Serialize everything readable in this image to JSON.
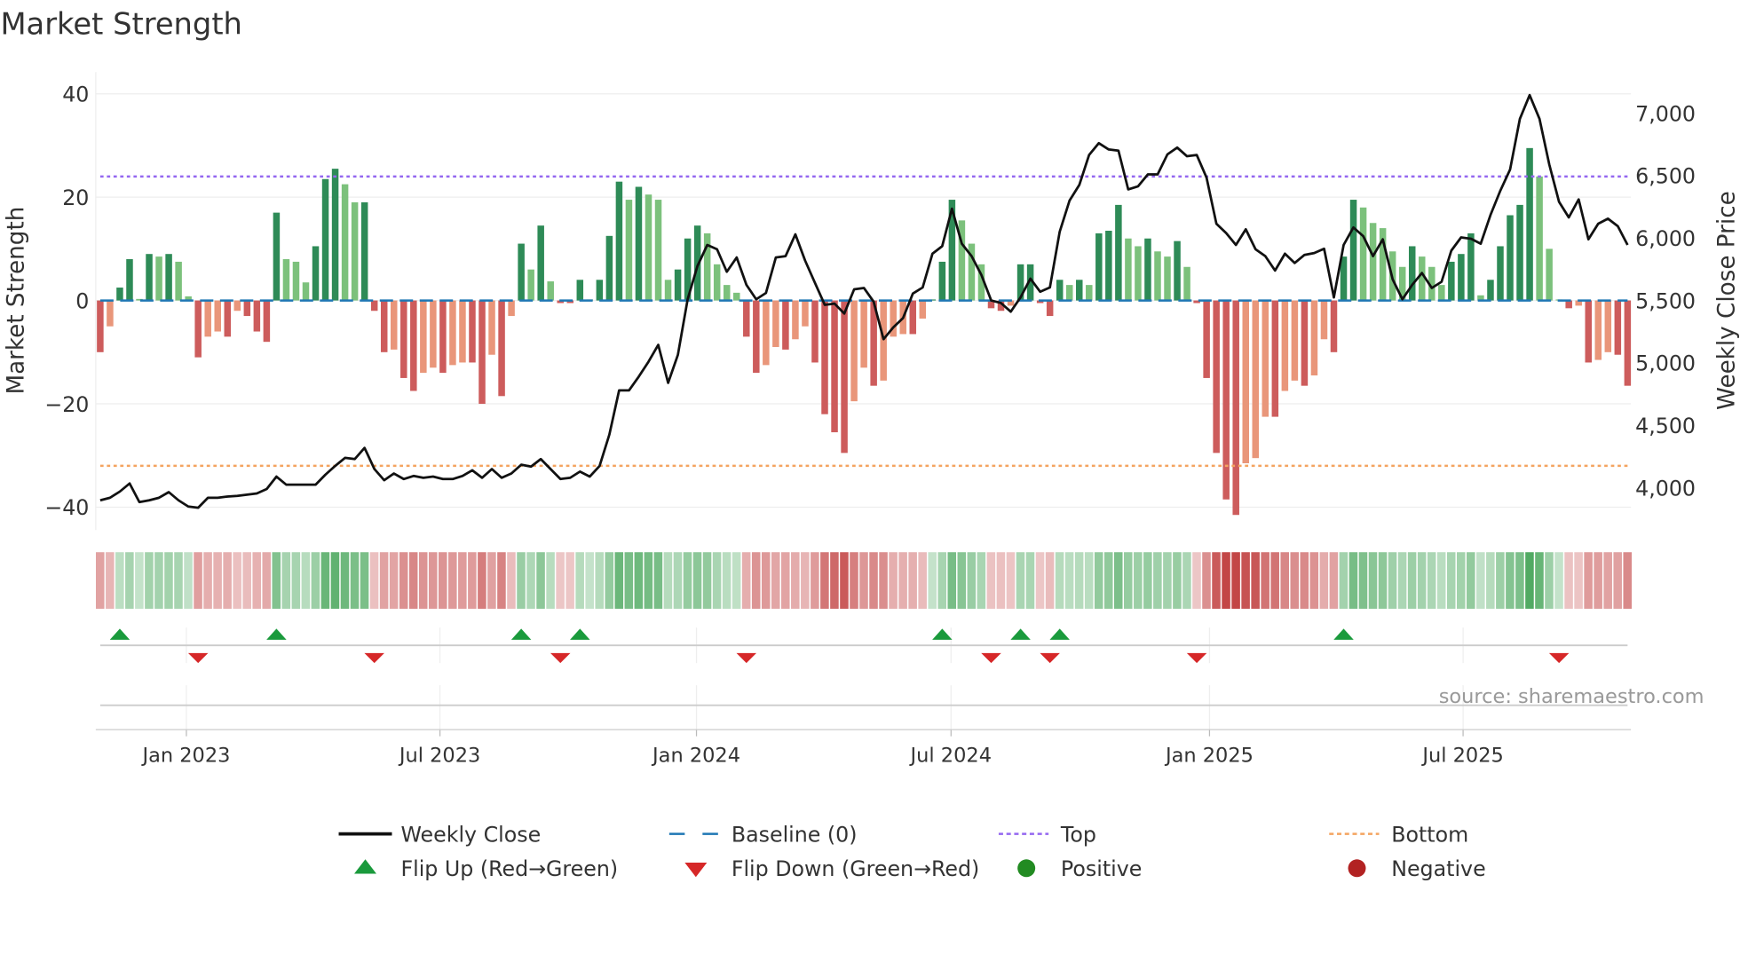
{
  "chart_data": {
    "type": "bar",
    "title": "Market Strength",
    "ylabel": "Market Strength",
    "y2label": "Weekly Close Price",
    "ylim": [
      -44,
      44
    ],
    "y2lim": [
      3750,
      7250
    ],
    "yticks": [
      {
        "v": 40,
        "label": "40"
      },
      {
        "v": 20,
        "label": "20"
      },
      {
        "v": 0,
        "label": "0"
      },
      {
        "v": -20,
        "label": "−20"
      },
      {
        "v": -40,
        "label": "−40"
      }
    ],
    "y2ticks": [
      {
        "v": 7000,
        "label": "7,000"
      },
      {
        "v": 6500,
        "label": "6,500"
      },
      {
        "v": 6000,
        "label": "6,000"
      },
      {
        "v": 5500,
        "label": "5,500"
      },
      {
        "v": 5000,
        "label": "5,000"
      },
      {
        "v": 4500,
        "label": "4,500"
      },
      {
        "v": 4000,
        "label": "4,000"
      }
    ],
    "xticks": [
      {
        "week": 8.8,
        "label": "Jan 2023"
      },
      {
        "week": 34.7,
        "label": "Jul 2023"
      },
      {
        "week": 60.9,
        "label": "Jan 2024"
      },
      {
        "week": 86.9,
        "label": "Jul 2024"
      },
      {
        "week": 113.3,
        "label": "Jan 2025"
      },
      {
        "week": 139.2,
        "label": "Jul 2025"
      }
    ],
    "top_level": 24,
    "bottom_level": -32,
    "strength": [
      -10,
      -5,
      2.5,
      8,
      0.3,
      9,
      8.5,
      9,
      7.5,
      0.8,
      -11,
      -7,
      -6,
      -7,
      -2,
      -3,
      -6,
      -8,
      17,
      8,
      7.5,
      3.5,
      10.5,
      23.5,
      25.5,
      22.5,
      19,
      19,
      -2,
      -10,
      -9.5,
      -15,
      -17.5,
      -14,
      -13,
      -14,
      -12.5,
      -12,
      -12,
      -20,
      -10.5,
      -18.5,
      -3,
      11,
      6,
      14.5,
      3.7,
      -0.5,
      -0.5,
      4,
      0.2,
      4,
      12.5,
      23,
      19.5,
      22,
      20.5,
      19.5,
      4,
      6,
      12,
      14.5,
      13,
      7,
      3,
      1.5,
      -7,
      -14,
      -12.5,
      -9,
      -9.5,
      -7.5,
      -5,
      -12,
      -22,
      -25.5,
      -29.5,
      -19.5,
      -13,
      -16.5,
      -15.5,
      -7,
      -6.5,
      -6.5,
      -3.5,
      0.2,
      7.5,
      19.5,
      15.5,
      11,
      7,
      -1.5,
      -2,
      -1,
      7,
      7,
      -0.5,
      -3,
      4,
      3,
      4,
      3,
      13,
      13.5,
      18.5,
      12,
      10.5,
      12,
      9.5,
      8.5,
      11.5,
      6.5,
      -0.5,
      -15,
      -29.5,
      -38.5,
      -41.5,
      -31.5,
      -30.5,
      -22.5,
      -22.5,
      -17.5,
      -15.5,
      -16.5,
      -14.5,
      -7.5,
      -10,
      8.5,
      19.5,
      18,
      15,
      14,
      9.5,
      6.5,
      10.5,
      8.5,
      6.5,
      3,
      7.5,
      9,
      13,
      1,
      4,
      10.5,
      16.5,
      18.5,
      29.5,
      24,
      10,
      0.2,
      -1.5,
      -1,
      -12,
      -11.5,
      -10,
      -10.5,
      -16.5
    ],
    "weekly_close": [
      3900,
      3920,
      3970,
      4035,
      3885,
      3900,
      3920,
      3965,
      3900,
      3850,
      3840,
      3920,
      3920,
      3930,
      3935,
      3945,
      3955,
      3990,
      4090,
      4025,
      4025,
      4025,
      4025,
      4105,
      4175,
      4240,
      4230,
      4320,
      4150,
      4060,
      4115,
      4070,
      4095,
      4080,
      4090,
      4070,
      4070,
      4095,
      4140,
      4080,
      4150,
      4080,
      4115,
      4185,
      4170,
      4230,
      4150,
      4070,
      4080,
      4130,
      4090,
      4175,
      4425,
      4780,
      4780,
      4890,
      5010,
      5145,
      4840,
      5065,
      5510,
      5775,
      5945,
      5910,
      5730,
      5845,
      5625,
      5510,
      5560,
      5845,
      5855,
      6030,
      5820,
      5640,
      5465,
      5475,
      5395,
      5590,
      5600,
      5490,
      5190,
      5285,
      5360,
      5555,
      5605,
      5875,
      5935,
      6235,
      5955,
      5855,
      5705,
      5500,
      5480,
      5410,
      5525,
      5675,
      5570,
      5605,
      6050,
      6300,
      6425,
      6665,
      6760,
      6710,
      6700,
      6390,
      6415,
      6510,
      6510,
      6670,
      6725,
      6655,
      6665,
      6485,
      6115,
      6040,
      5945,
      6070,
      5910,
      5855,
      5740,
      5875,
      5800,
      5865,
      5880,
      5915,
      5525,
      5945,
      6085,
      6015,
      5855,
      5990,
      5670,
      5510,
      5625,
      5720,
      5600,
      5650,
      5900,
      6005,
      5995,
      5955,
      6185,
      6380,
      6550,
      6955,
      7145,
      6955,
      6590,
      6290,
      6165,
      6310,
      5990,
      6115,
      6155,
      6095,
      5945
    ],
    "flip_up_weeks": [
      2,
      18,
      43,
      49,
      86,
      94,
      98,
      127
    ],
    "flip_down_weeks": [
      10,
      28,
      47,
      66,
      91,
      97,
      112,
      149
    ],
    "source": "source: sharemaestro.com",
    "legend": [
      {
        "label": "Weekly Close",
        "kind": "line"
      },
      {
        "label": "Baseline (0)",
        "kind": "dash"
      },
      {
        "label": "Top",
        "kind": "top"
      },
      {
        "label": "Bottom",
        "kind": "bottom"
      },
      {
        "label": "Flip Up (Red→Green)",
        "kind": "up"
      },
      {
        "label": "Flip Down (Green→Red)",
        "kind": "down"
      },
      {
        "label": "Positive",
        "kind": "pos"
      },
      {
        "label": "Negative",
        "kind": "neg"
      }
    ],
    "colors": {
      "green_dark": "#2e8b57",
      "green_light": "#7cc17c",
      "red_dark": "#cd5c5c",
      "red_light": "#e9967a",
      "baseline": "#1f77b4",
      "top": "#9467f0",
      "bottom": "#f4a460",
      "line": "#111111",
      "flip_up": "#1a9a3c",
      "flip_down": "#d62728",
      "positive": "#228b22",
      "negative": "#b22222"
    }
  }
}
